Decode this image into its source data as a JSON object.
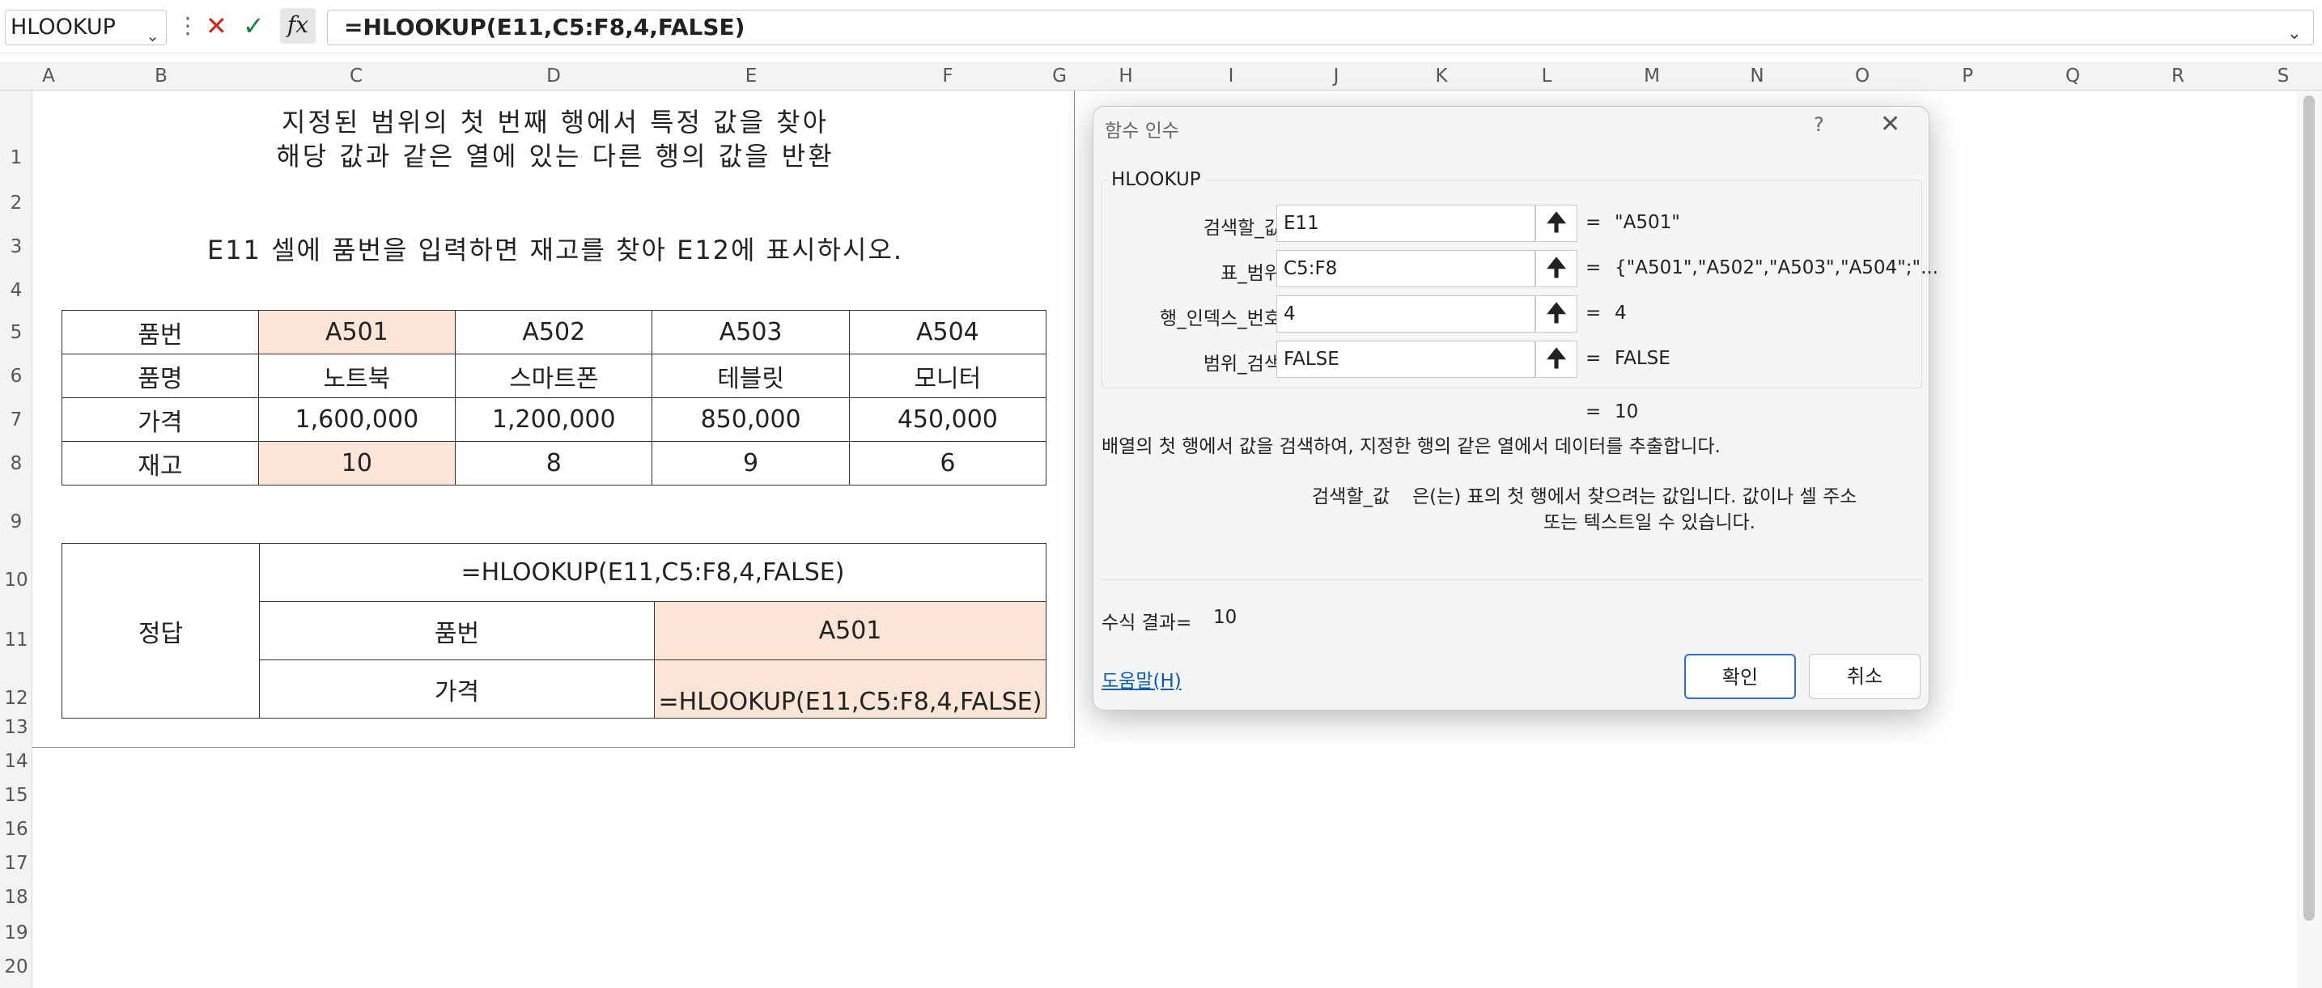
{
  "formula_bar": {
    "name_box": "HLOOKUP",
    "formula": "=HLOOKUP(E11,C5:F8,4,FALSE)"
  },
  "columns": [
    "A",
    "B",
    "C",
    "D",
    "E",
    "F",
    "G",
    "H",
    "I",
    "J",
    "K",
    "L",
    "M",
    "N",
    "O",
    "P",
    "Q",
    "R",
    "S"
  ],
  "rows": [
    "1",
    "2",
    "3",
    "4",
    "5",
    "6",
    "7",
    "8",
    "9",
    "10",
    "11",
    "12",
    "13",
    "14",
    "15",
    "16",
    "17",
    "18",
    "19",
    "20"
  ],
  "sheet": {
    "title_line1": "지정된 범위의 첫 번째 행에서 특정 값을 찾아",
    "title_line2": "해당 값과 같은 열에 있는 다른 행의 값을 반환",
    "instruction": "E11 셀에 품번을 입력하면 재고를 찾아 E12에 표시하시오.",
    "table": [
      [
        "품번",
        "A501",
        "A502",
        "A503",
        "A504"
      ],
      [
        "품명",
        "노트북",
        "스마트폰",
        "테블릿",
        "모니터"
      ],
      [
        "가격",
        "1,600,000",
        "1,200,000",
        "850,000",
        "450,000"
      ],
      [
        "재고",
        "10",
        "8",
        "9",
        "6"
      ]
    ],
    "answer": {
      "label": "정답",
      "formula_text": "=HLOOKUP(E11,C5:F8,4,FALSE)",
      "row1_label": "품번",
      "row1_value": "A501",
      "row2_label": "가격",
      "row2_value": "=HLOOKUP(E11,C5:F8,4,FALSE)"
    },
    "highlight_color": "#fbe5d6"
  },
  "dialog": {
    "title": "함수 인수",
    "help_glyph": "?",
    "function_name": "HLOOKUP",
    "args": [
      {
        "label": "검색할_값",
        "value": "E11",
        "result": "\"A501\""
      },
      {
        "label": "표_범위",
        "value": "C5:F8",
        "result": "{\"A501\",\"A502\",\"A503\",\"A504\";\"..."
      },
      {
        "label": "행_인덱스_번호",
        "value": "4",
        "result": "4"
      },
      {
        "label": "범위_검색",
        "value": "FALSE",
        "result": "FALSE"
      }
    ],
    "equals": "=",
    "overall_result": "10",
    "description": "배열의 첫 행에서 값을 검색하여, 지정한 행의 같은 열에서 데이터를 추출합니다.",
    "arg_help_name": "검색할_값",
    "arg_help_line1": "은(는) 표의 첫 행에서 찾으려는 값입니다. 값이나 셀 주소",
    "arg_help_line2": "또는 텍스트일 수 있습니다.",
    "formula_result_label": "수식 결과=",
    "formula_result_value": "10",
    "help_link": "도움말(H)",
    "ok_label": "확인",
    "cancel_label": "취소"
  }
}
